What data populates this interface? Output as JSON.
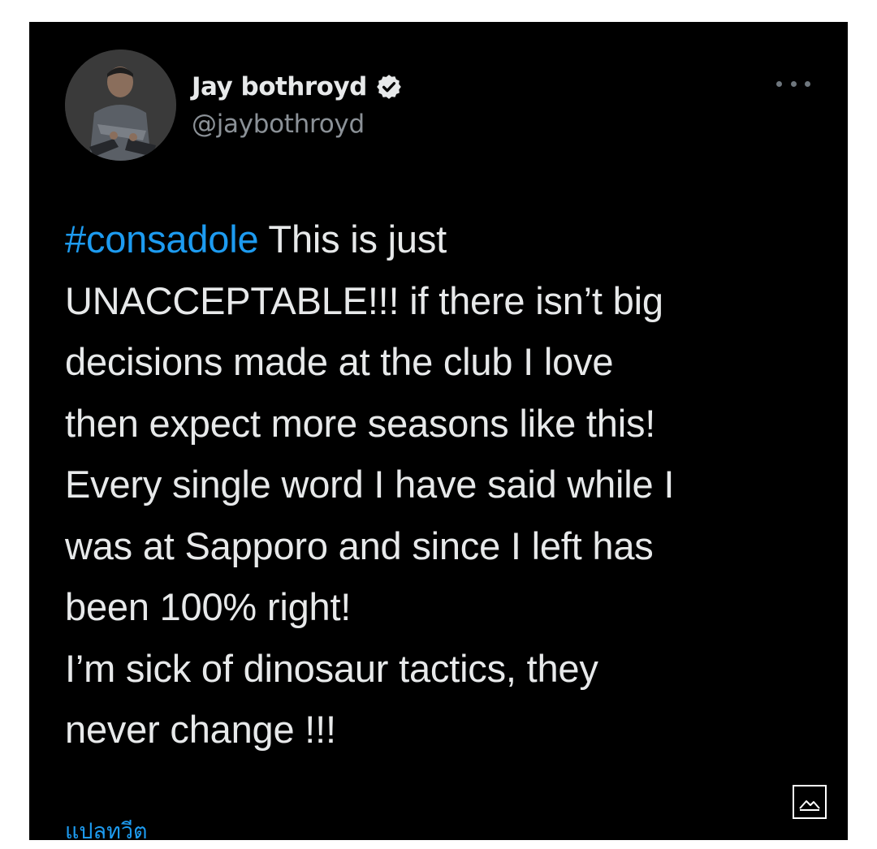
{
  "profile": {
    "display_name": "Jay bothroyd",
    "handle": "@jaybothroyd",
    "verified": true
  },
  "icons": {
    "verified": "verified-badge-icon",
    "more": "more-options-icon",
    "media": "image-icon"
  },
  "tweet": {
    "hashtag": "#consadole",
    "lines": [
      " This is just",
      "UNACCEPTABLE!!! if there isn’t big",
      "decisions made at the club I love",
      "then expect more seasons like this!",
      "Every single word I have said while I",
      "was at Sapporo and since I left has",
      "been 100% right!",
      "I’m sick of dinosaur tactics, they",
      "never change !!!"
    ]
  },
  "translate_label": "แปลทวีต",
  "colors": {
    "background": "#000000",
    "text": "#e7e9ea",
    "secondary_text": "#8b9197",
    "link": "#1d9bf0"
  }
}
